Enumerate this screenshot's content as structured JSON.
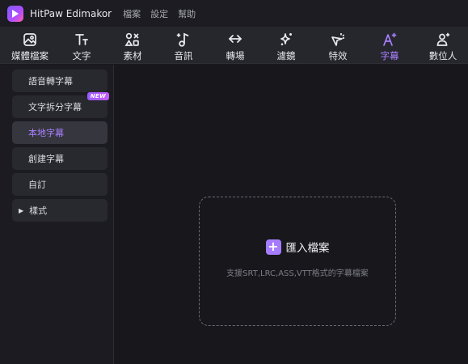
{
  "app": {
    "name": "HitPaw Edimakor"
  },
  "menu": [
    "檔案",
    "設定",
    "幫助"
  ],
  "toolbar": {
    "tabs": [
      {
        "label": "媒體檔案",
        "icon": "media-files-icon"
      },
      {
        "label": "文字",
        "icon": "text-icon"
      },
      {
        "label": "素材",
        "icon": "assets-icon"
      },
      {
        "label": "音訊",
        "icon": "audio-icon"
      },
      {
        "label": "轉場",
        "icon": "transition-icon"
      },
      {
        "label": "濾鏡",
        "icon": "filter-icon"
      },
      {
        "label": "特效",
        "icon": "effects-icon"
      },
      {
        "label": "字幕",
        "icon": "subtitles-icon",
        "active": true
      },
      {
        "label": "數位人",
        "icon": "digital-human-icon"
      }
    ],
    "accent": "#a980ff"
  },
  "sidebar": {
    "items": [
      {
        "label": "語音轉字幕"
      },
      {
        "label": "文字拆分字幕",
        "badge": "NEW"
      },
      {
        "label": "本地字幕",
        "active": true
      },
      {
        "label": "創建字幕"
      },
      {
        "label": "自訂"
      },
      {
        "label": "樣式",
        "expandable": true
      }
    ]
  },
  "main": {
    "import_label": "匯入檔案",
    "import_hint": "支援SRT,LRC,ASS,VTT格式的字幕檔案"
  }
}
